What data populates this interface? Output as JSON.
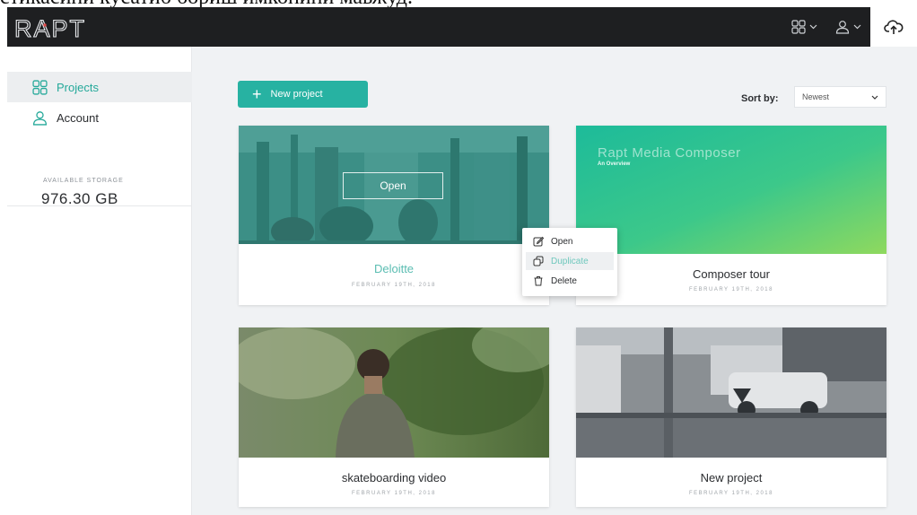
{
  "caption": "стикасини кусатиб бориш имконини мавжуд.",
  "app": {
    "logo_text": "RAPT"
  },
  "sidebar": {
    "items": [
      {
        "label": "Projects",
        "icon": "grid-icon",
        "active": true
      },
      {
        "label": "Account",
        "icon": "user-icon",
        "active": false
      }
    ],
    "storage_label": "AVAILABLE STORAGE",
    "storage_value": "976.30 GB"
  },
  "toolbar": {
    "new_project_label": "New project",
    "sort_label": "Sort by:",
    "sort_value": "Newest"
  },
  "projects": [
    {
      "title": "Deloitte",
      "date": "FEBRUARY 19TH, 2018",
      "hover_open_label": "Open"
    },
    {
      "title": "Composer tour",
      "date": "FEBRUARY 19TH, 2018",
      "thumb_title": "Rapt Media Composer",
      "thumb_subtitle": "An Overview"
    },
    {
      "title": "skateboarding video",
      "date": "FEBRUARY 19TH, 2018"
    },
    {
      "title": "New project",
      "date": "FEBRUARY 19TH, 2018"
    }
  ],
  "context_menu": {
    "items": [
      {
        "label": "Open",
        "icon": "edit-icon"
      },
      {
        "label": "Duplicate",
        "icon": "duplicate-icon"
      },
      {
        "label": "Delete",
        "icon": "trash-icon"
      }
    ]
  },
  "colors": {
    "accent": "#27b2a2",
    "topbar": "#1e1f21",
    "main_bg": "#f0f2f4"
  }
}
